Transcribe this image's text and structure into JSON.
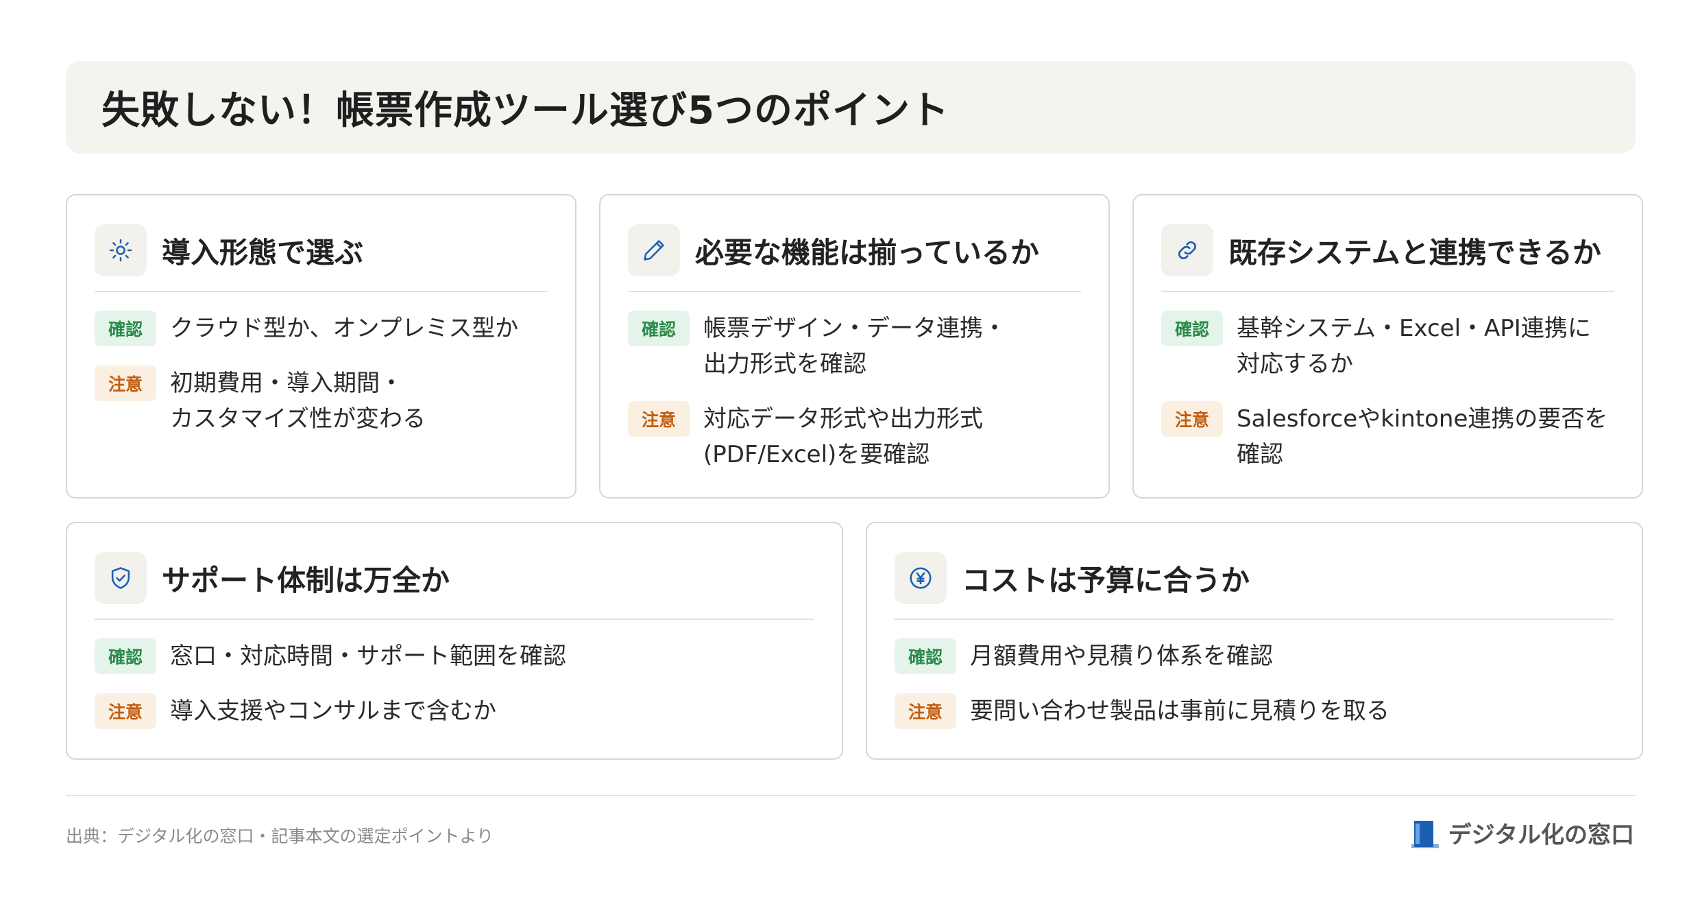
{
  "title": "失敗しない！帳票作成ツール選び5つのポイント",
  "cards": [
    {
      "title": "導入形態で選ぶ",
      "icon": "sun-icon",
      "items": [
        {
          "badge": "確認",
          "text": "クラウド型か、オンプレミス型か"
        },
        {
          "badge": "注意",
          "text": "初期費用・導入期間・\nカスタマイズ性が変わる"
        }
      ]
    },
    {
      "title": "必要な機能は揃っているか",
      "icon": "pencil-icon",
      "items": [
        {
          "badge": "確認",
          "text": "帳票デザイン・データ連携・\n出力形式を確認"
        },
        {
          "badge": "注意",
          "text": "対応データ形式や出力形式\n(PDF/Excel)を要確認"
        }
      ]
    },
    {
      "title": "既存システムと連携できるか",
      "icon": "link-icon",
      "items": [
        {
          "badge": "確認",
          "text": "基幹システム・Excel・API連携に\n対応するか"
        },
        {
          "badge": "注意",
          "text": "Salesforceやkintone連携の要否を\n確認"
        }
      ]
    },
    {
      "title": "サポート体制は万全か",
      "icon": "shield-check-icon",
      "items": [
        {
          "badge": "確認",
          "text": "窓口・対応時間・サポート範囲を確認"
        },
        {
          "badge": "注意",
          "text": "導入支援やコンサルまで含むか"
        }
      ]
    },
    {
      "title": "コストは予算に合うか",
      "icon": "yen-circle-icon",
      "items": [
        {
          "badge": "確認",
          "text": "月額費用や見積り体系を確認"
        },
        {
          "badge": "注意",
          "text": "要問い合わせ製品は事前に見積りを取る"
        }
      ]
    }
  ],
  "source": "出典：デジタル化の窓口・記事本文の選定ポイントより",
  "brand": "デジタル化の窓口",
  "colors": {
    "accent": "#1a5fb4",
    "ok": "#2c8a4a",
    "warn": "#c25e12",
    "title_bg": "#f5f3ee"
  }
}
